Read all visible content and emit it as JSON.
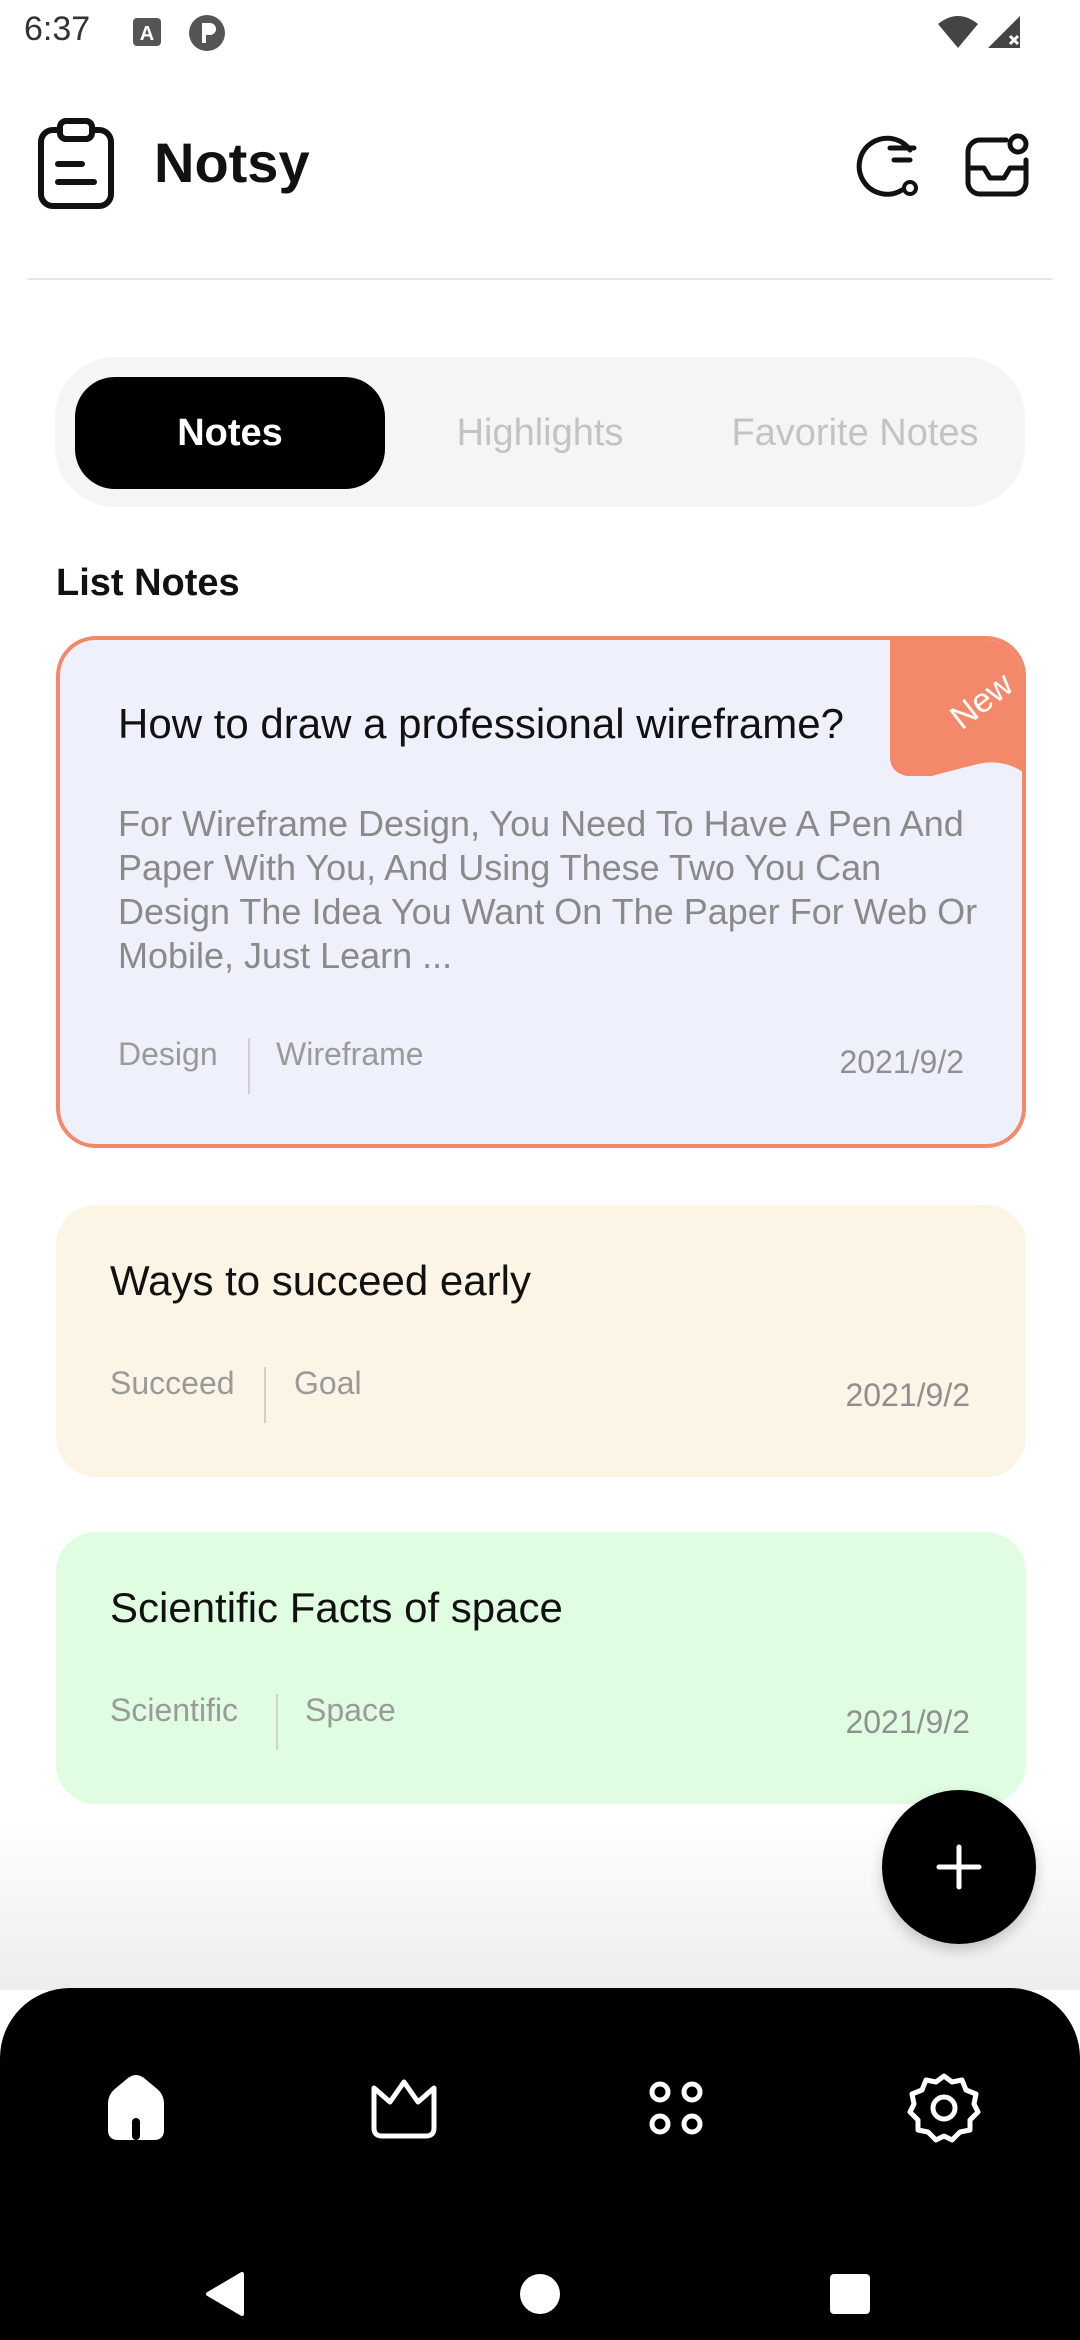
{
  "status_bar": {
    "time": "6:37",
    "icons": [
      "a-badge-icon",
      "p-circle-icon",
      "wifi-icon",
      "signal-icon"
    ]
  },
  "header": {
    "app_name": "Notsy",
    "logo_icon": "clipboard-icon",
    "actions": [
      "sort-icon",
      "inbox-icon"
    ]
  },
  "tabs": [
    {
      "label": "Notes",
      "active": true
    },
    {
      "label": "Highlights",
      "active": false
    },
    {
      "label": "Favorite Notes",
      "active": false
    }
  ],
  "section_title": "List Notes",
  "notes": [
    {
      "title": "How to draw a professional wireframe?",
      "body": "For Wireframe Design, You Need To Have A Pen And Paper With You, And Using These Two You Can Design The Idea You Want On The Paper For Web Or Mobile, Just Learn ...",
      "tags": [
        "Design",
        "Wireframe"
      ],
      "date": "2021/9/2",
      "badge": "New",
      "color": "#eef1fb",
      "border": "#f3896a"
    },
    {
      "title": "Ways to succeed early",
      "tags": [
        "Succeed",
        "Goal"
      ],
      "date": "2021/9/2",
      "color": "#fcf4e4"
    },
    {
      "title": "Scientific Facts of space",
      "tags": [
        "Scientific",
        "Space"
      ],
      "date": "2021/9/2",
      "color": "#e0fde2"
    }
  ],
  "fab_icon": "plus-icon",
  "bottom_nav": [
    "home-icon",
    "crown-icon",
    "grid-dots-icon",
    "gear-icon"
  ],
  "system_nav": [
    "back-icon",
    "home-circle-icon",
    "recents-icon"
  ],
  "colors": {
    "accent": "#f3896a",
    "dark": "#000000"
  }
}
